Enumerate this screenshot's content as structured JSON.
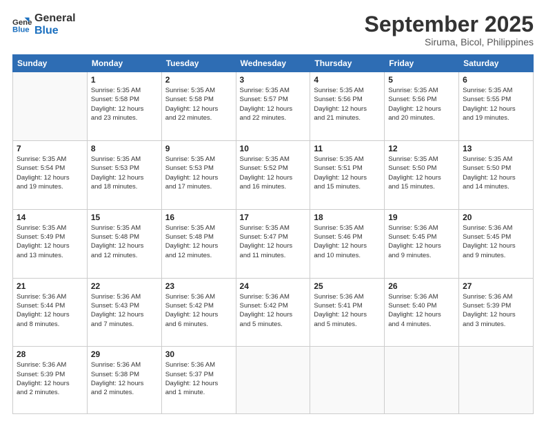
{
  "logo": {
    "text_general": "General",
    "text_blue": "Blue"
  },
  "header": {
    "month": "September 2025",
    "location": "Siruma, Bicol, Philippines"
  },
  "weekdays": [
    "Sunday",
    "Monday",
    "Tuesday",
    "Wednesday",
    "Thursday",
    "Friday",
    "Saturday"
  ],
  "weeks": [
    [
      {
        "day": "",
        "info": ""
      },
      {
        "day": "1",
        "info": "Sunrise: 5:35 AM\nSunset: 5:58 PM\nDaylight: 12 hours\nand 23 minutes."
      },
      {
        "day": "2",
        "info": "Sunrise: 5:35 AM\nSunset: 5:58 PM\nDaylight: 12 hours\nand 22 minutes."
      },
      {
        "day": "3",
        "info": "Sunrise: 5:35 AM\nSunset: 5:57 PM\nDaylight: 12 hours\nand 22 minutes."
      },
      {
        "day": "4",
        "info": "Sunrise: 5:35 AM\nSunset: 5:56 PM\nDaylight: 12 hours\nand 21 minutes."
      },
      {
        "day": "5",
        "info": "Sunrise: 5:35 AM\nSunset: 5:56 PM\nDaylight: 12 hours\nand 20 minutes."
      },
      {
        "day": "6",
        "info": "Sunrise: 5:35 AM\nSunset: 5:55 PM\nDaylight: 12 hours\nand 19 minutes."
      }
    ],
    [
      {
        "day": "7",
        "info": "Sunrise: 5:35 AM\nSunset: 5:54 PM\nDaylight: 12 hours\nand 19 minutes."
      },
      {
        "day": "8",
        "info": "Sunrise: 5:35 AM\nSunset: 5:53 PM\nDaylight: 12 hours\nand 18 minutes."
      },
      {
        "day": "9",
        "info": "Sunrise: 5:35 AM\nSunset: 5:53 PM\nDaylight: 12 hours\nand 17 minutes."
      },
      {
        "day": "10",
        "info": "Sunrise: 5:35 AM\nSunset: 5:52 PM\nDaylight: 12 hours\nand 16 minutes."
      },
      {
        "day": "11",
        "info": "Sunrise: 5:35 AM\nSunset: 5:51 PM\nDaylight: 12 hours\nand 15 minutes."
      },
      {
        "day": "12",
        "info": "Sunrise: 5:35 AM\nSunset: 5:50 PM\nDaylight: 12 hours\nand 15 minutes."
      },
      {
        "day": "13",
        "info": "Sunrise: 5:35 AM\nSunset: 5:50 PM\nDaylight: 12 hours\nand 14 minutes."
      }
    ],
    [
      {
        "day": "14",
        "info": "Sunrise: 5:35 AM\nSunset: 5:49 PM\nDaylight: 12 hours\nand 13 minutes."
      },
      {
        "day": "15",
        "info": "Sunrise: 5:35 AM\nSunset: 5:48 PM\nDaylight: 12 hours\nand 12 minutes."
      },
      {
        "day": "16",
        "info": "Sunrise: 5:35 AM\nSunset: 5:48 PM\nDaylight: 12 hours\nand 12 minutes."
      },
      {
        "day": "17",
        "info": "Sunrise: 5:35 AM\nSunset: 5:47 PM\nDaylight: 12 hours\nand 11 minutes."
      },
      {
        "day": "18",
        "info": "Sunrise: 5:35 AM\nSunset: 5:46 PM\nDaylight: 12 hours\nand 10 minutes."
      },
      {
        "day": "19",
        "info": "Sunrise: 5:36 AM\nSunset: 5:45 PM\nDaylight: 12 hours\nand 9 minutes."
      },
      {
        "day": "20",
        "info": "Sunrise: 5:36 AM\nSunset: 5:45 PM\nDaylight: 12 hours\nand 9 minutes."
      }
    ],
    [
      {
        "day": "21",
        "info": "Sunrise: 5:36 AM\nSunset: 5:44 PM\nDaylight: 12 hours\nand 8 minutes."
      },
      {
        "day": "22",
        "info": "Sunrise: 5:36 AM\nSunset: 5:43 PM\nDaylight: 12 hours\nand 7 minutes."
      },
      {
        "day": "23",
        "info": "Sunrise: 5:36 AM\nSunset: 5:42 PM\nDaylight: 12 hours\nand 6 minutes."
      },
      {
        "day": "24",
        "info": "Sunrise: 5:36 AM\nSunset: 5:42 PM\nDaylight: 12 hours\nand 5 minutes."
      },
      {
        "day": "25",
        "info": "Sunrise: 5:36 AM\nSunset: 5:41 PM\nDaylight: 12 hours\nand 5 minutes."
      },
      {
        "day": "26",
        "info": "Sunrise: 5:36 AM\nSunset: 5:40 PM\nDaylight: 12 hours\nand 4 minutes."
      },
      {
        "day": "27",
        "info": "Sunrise: 5:36 AM\nSunset: 5:39 PM\nDaylight: 12 hours\nand 3 minutes."
      }
    ],
    [
      {
        "day": "28",
        "info": "Sunrise: 5:36 AM\nSunset: 5:39 PM\nDaylight: 12 hours\nand 2 minutes."
      },
      {
        "day": "29",
        "info": "Sunrise: 5:36 AM\nSunset: 5:38 PM\nDaylight: 12 hours\nand 2 minutes."
      },
      {
        "day": "30",
        "info": "Sunrise: 5:36 AM\nSunset: 5:37 PM\nDaylight: 12 hours\nand 1 minute."
      },
      {
        "day": "",
        "info": ""
      },
      {
        "day": "",
        "info": ""
      },
      {
        "day": "",
        "info": ""
      },
      {
        "day": "",
        "info": ""
      }
    ]
  ]
}
